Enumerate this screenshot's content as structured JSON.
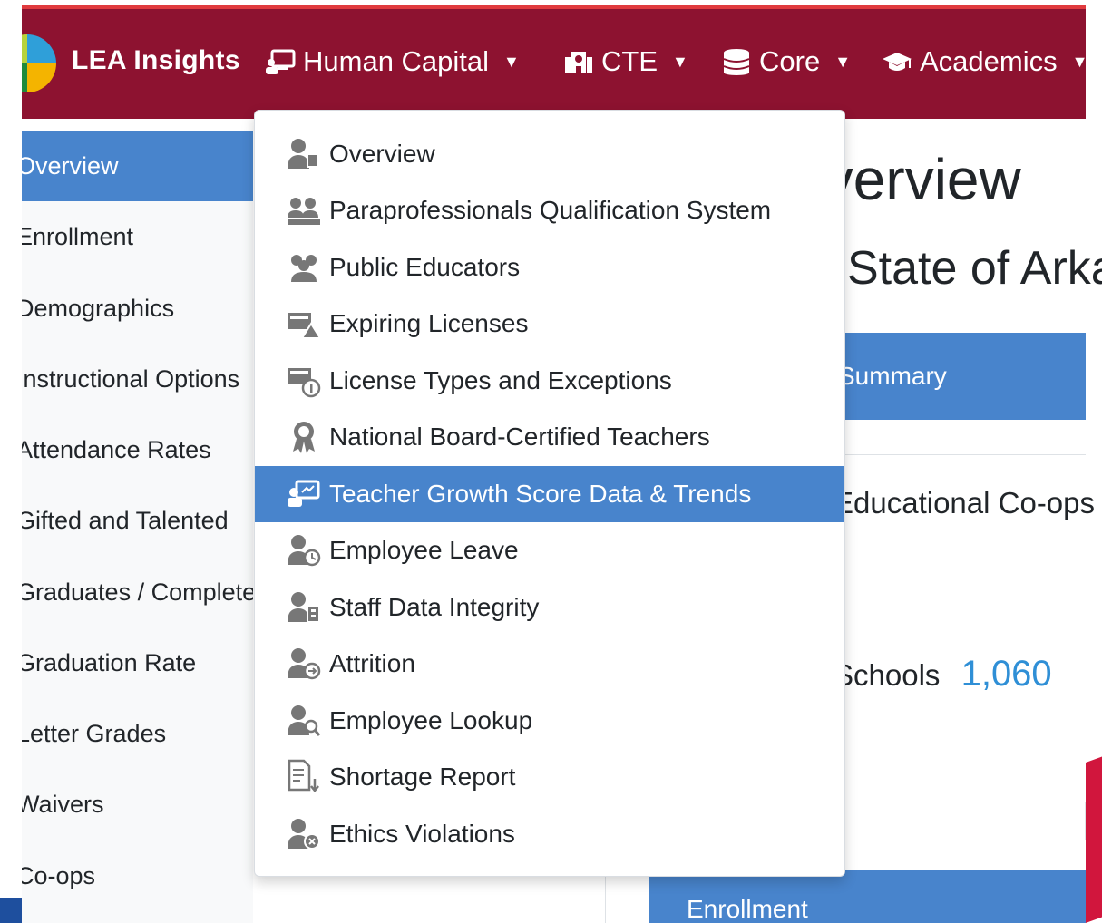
{
  "navbar": {
    "brand": "LEA Insights",
    "items": [
      {
        "label": "Human Capital",
        "icon": "presentation-icon"
      },
      {
        "label": "CTE",
        "icon": "school-building-icon"
      },
      {
        "label": "Core",
        "icon": "database-icon"
      },
      {
        "label": "Academics",
        "icon": "graduation-cap-icon"
      }
    ]
  },
  "sidebar": {
    "items": [
      {
        "label": "Overview",
        "active": true
      },
      {
        "label": "Enrollment"
      },
      {
        "label": "Demographics"
      },
      {
        "label": "Instructional Options"
      },
      {
        "label": "Attendance Rates"
      },
      {
        "label": "Gifted and Talented"
      },
      {
        "label": "Graduates / Completers"
      },
      {
        "label": "Graduation Rate"
      },
      {
        "label": "Letter Grades"
      },
      {
        "label": "Waivers"
      },
      {
        "label": "Co-ops"
      }
    ]
  },
  "main": {
    "title": "Overview",
    "subtitle": "State of Arkansas",
    "card_header": "Summary",
    "coops_label": "Educational Co-ops",
    "schools_label": "Schools",
    "schools_value": "1,060",
    "card3_header": "Enrollment"
  },
  "dropdown": {
    "items": [
      {
        "label": "Overview",
        "icon": "user-overview-icon"
      },
      {
        "label": "Paraprofessionals Qualification System",
        "icon": "users-qualification-icon"
      },
      {
        "label": "Public Educators",
        "icon": "users-group-icon"
      },
      {
        "label": "Expiring Licenses",
        "icon": "license-warning-icon"
      },
      {
        "label": "License Types and Exceptions",
        "icon": "license-info-icon"
      },
      {
        "label": "National Board-Certified Teachers",
        "icon": "award-ribbon-icon"
      },
      {
        "label": "Teacher Growth Score Data & Trends",
        "icon": "teacher-chart-icon",
        "active": true
      },
      {
        "label": "Employee Leave",
        "icon": "user-clock-icon"
      },
      {
        "label": "Staff Data Integrity",
        "icon": "user-building-icon"
      },
      {
        "label": "Attrition",
        "icon": "user-exit-icon"
      },
      {
        "label": "Employee Lookup",
        "icon": "user-search-icon"
      },
      {
        "label": "Shortage Report",
        "icon": "report-download-icon"
      },
      {
        "label": "Ethics Violations",
        "icon": "user-x-icon"
      }
    ]
  },
  "colors": {
    "navbar": "#8d1230",
    "accent_blue": "#4884cc",
    "number_blue": "#2f8fd6"
  }
}
